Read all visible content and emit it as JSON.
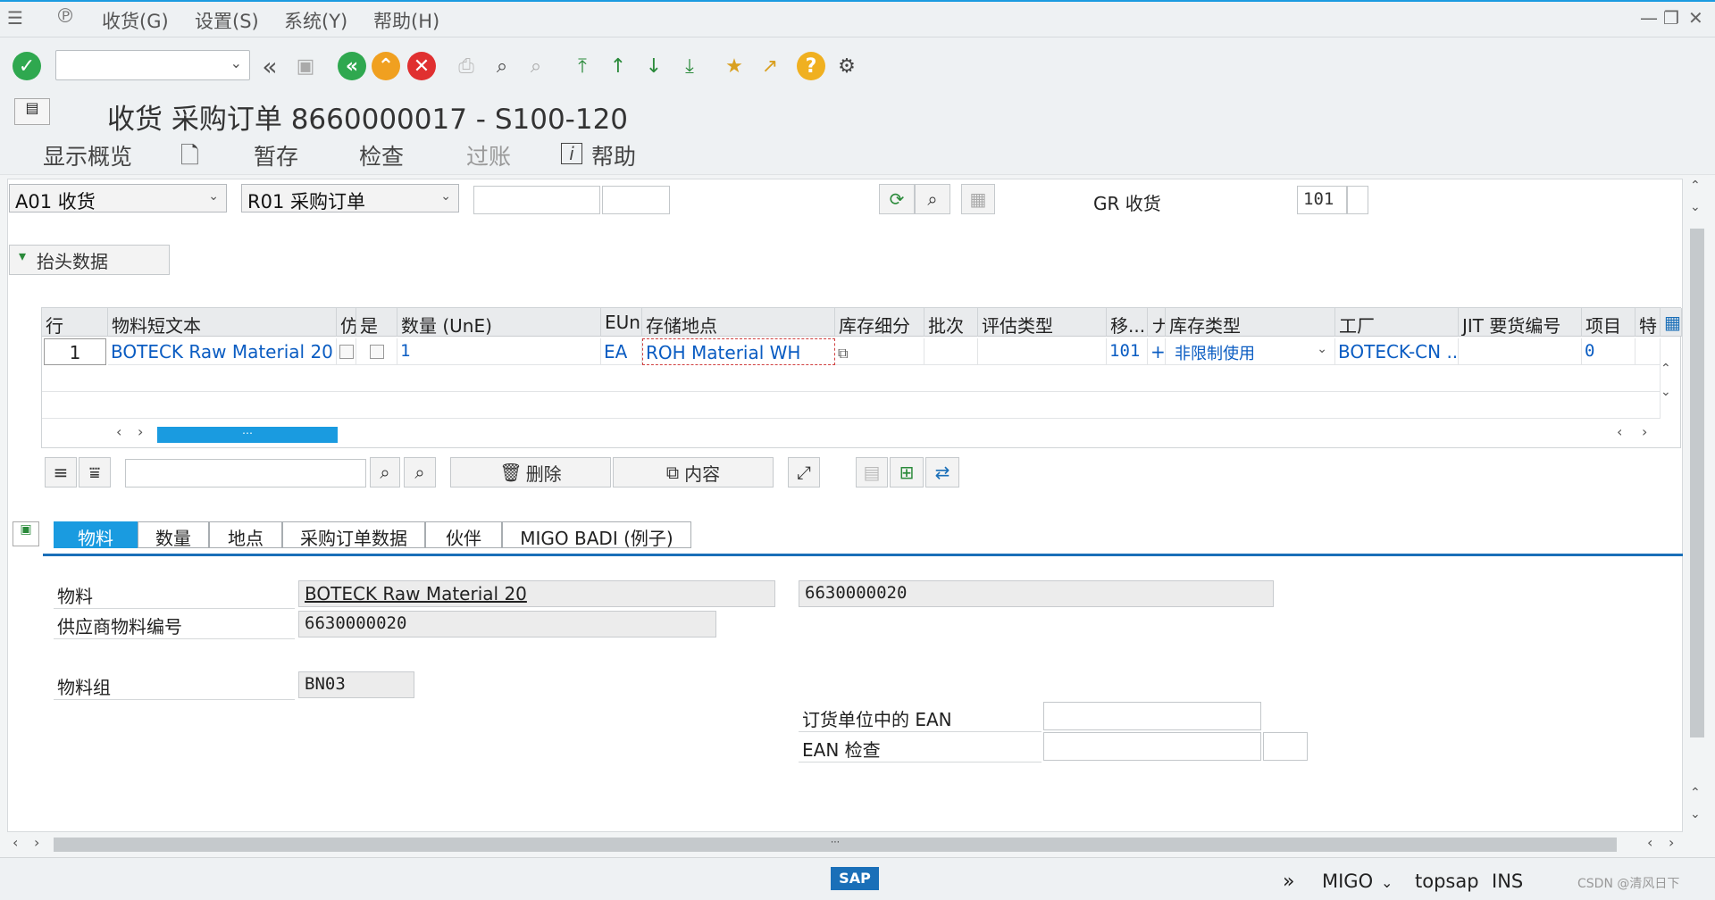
{
  "menu": {
    "items": [
      "收货(G)",
      "设置(S)",
      "系统(Y)",
      "帮助(H)"
    ]
  },
  "toolbar": {
    "icons": [
      "enter-icon",
      "back-icon",
      "save-icon",
      "back-green-icon",
      "exit-icon",
      "cancel-icon",
      "print-icon",
      "find-icon",
      "find-next-icon",
      "first-page-icon",
      "prev-page-icon",
      "next-page-icon",
      "last-page-icon",
      "create-session-icon",
      "shortcut-icon",
      "help-icon",
      "settings-icon"
    ]
  },
  "title": "收货 采购订单 8660000017 - S100-120",
  "app_toolbar": {
    "overview": "显示概览",
    "hold": "暂存",
    "check": "检查",
    "post": "过账",
    "help": "帮助"
  },
  "header": {
    "action": "A01 收货",
    "reference": "R01 采购订单",
    "gr_label": "GR 收货",
    "movement_type": "101",
    "header_data_button": "抬头数据"
  },
  "grid": {
    "columns": [
      "行",
      "物料短文本",
      "仿",
      "是",
      "数量 (UnE)",
      "EUn",
      "存储地点",
      "库存细分",
      "批次",
      "评估类型",
      "移...",
      "ナ",
      "库存类型",
      "工厂",
      "JIT 要货编号",
      "项目",
      "特"
    ],
    "row": {
      "line": "1",
      "material_text": "BOTECK Raw Material 20",
      "quantity": "1",
      "unit": "EA",
      "storage_location": "ROH Material WH",
      "movement": "101",
      "sign": "+",
      "stock_type": "非限制使用",
      "plant": "BOTECK-CN ...",
      "item": "0"
    }
  },
  "grid_toolbar": {
    "delete": "删除",
    "content": "内容"
  },
  "tabs": [
    "物料",
    "数量",
    "地点",
    "采购订单数据",
    "伙伴",
    "MIGO BADI (例子)"
  ],
  "material_tab": {
    "material_label": "物料",
    "material_value": "BOTECK Raw Material 20",
    "material_number": "6630000020",
    "vendor_material_label": "供应商物料编号",
    "vendor_material_value": "6630000020",
    "material_group_label": "物料组",
    "material_group_value": "BN03",
    "ean_order_unit_label": "订货单位中的  EAN",
    "ean_check_label": "EAN 检查"
  },
  "status": {
    "transaction": "MIGO",
    "system": "topsap",
    "mode": "INS",
    "watermark": "CSDN @清风日下"
  },
  "colors": {
    "accent": "#1a9be0",
    "link_blue": "#0a5cc2"
  }
}
